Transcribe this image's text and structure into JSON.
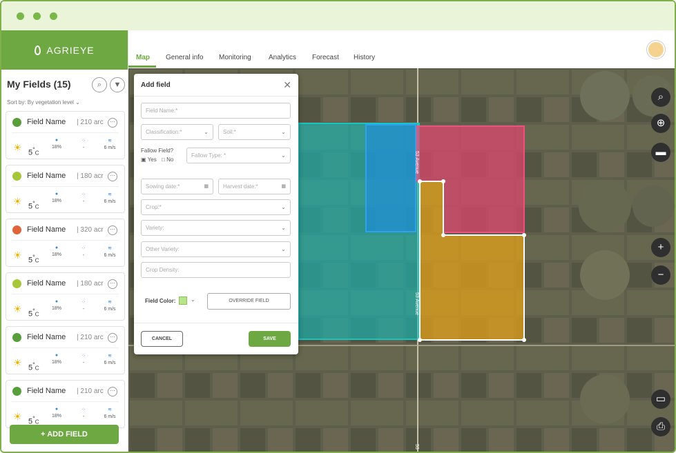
{
  "app": {
    "brand": "AGRIEYE"
  },
  "nav": {
    "tabs": [
      {
        "label": "Map",
        "active": true
      },
      {
        "label": "General info",
        "active": false
      },
      {
        "label": "Monitoring",
        "active": false
      },
      {
        "label": "Analytics",
        "active": false
      },
      {
        "label": "Forecast",
        "active": false
      },
      {
        "label": "History",
        "active": false
      }
    ]
  },
  "sidebar": {
    "title": "My Fields (15)",
    "sort": "Sort by: By vegetation level",
    "fields": [
      {
        "name": "Field Name",
        "area": "210 arc",
        "status_color": "#5a9e3c",
        "temp": "5",
        "temp_unit": "C",
        "humidity": "18%",
        "rain": "-",
        "wind": "6 m/s"
      },
      {
        "name": "Field Name",
        "area": "180 acr",
        "status_color": "#a7c63a",
        "temp": "5",
        "temp_unit": "C",
        "humidity": "18%",
        "rain": "-",
        "wind": "6 m/s"
      },
      {
        "name": "Field Name",
        "area": "320 acr",
        "status_color": "#e0643a",
        "temp": "5",
        "temp_unit": "C",
        "humidity": "18%",
        "rain": "-",
        "wind": "6 m/s"
      },
      {
        "name": "Field Name",
        "area": "180 acr",
        "status_color": "#a7c63a",
        "temp": "5",
        "temp_unit": "C",
        "humidity": "18%",
        "rain": "-",
        "wind": "6 m/s"
      },
      {
        "name": "Field Name",
        "area": "210 arc",
        "status_color": "#5a9e3c",
        "temp": "5",
        "temp_unit": "C",
        "humidity": "18%",
        "rain": "-",
        "wind": "6 m/s"
      },
      {
        "name": "Field Name",
        "area": "210 arc",
        "status_color": "#5a9e3c",
        "temp": "5",
        "temp_unit": "C",
        "humidity": "18%",
        "rain": "-",
        "wind": "6 m/s"
      }
    ],
    "add_button": "+ ADD FIELD"
  },
  "modal": {
    "title": "Add field",
    "field_name_placeholder": "Field Name:*",
    "classification_placeholder": "Classification:*",
    "soil_placeholder": "Soil:*",
    "fallow_label": "Fallow Field?",
    "fallow_yes": "Yes",
    "fallow_no": "No",
    "fallow_type_placeholder": "Fallow Type: *",
    "sowing_placeholder": "Sowing date:*",
    "harvest_placeholder": "Harvest date:*",
    "crop_placeholder": "Crop:*",
    "variety_placeholder": "Variety:",
    "other_variety_placeholder": "Other Variety:",
    "crop_density_placeholder": "Crop Density:",
    "field_color_label": "Field Color:",
    "override_button": "OVERRIDE FIELD",
    "cancel_button": "CANCEL",
    "save_button": "SAVE"
  },
  "map": {
    "road_labels": [
      "53 Avenue",
      "53 Avenue",
      "53"
    ]
  },
  "colors": {
    "accent": "#6da843",
    "field_teal": "#19b3b0",
    "field_blue": "#1f8fd8",
    "field_pink": "#e2446f",
    "field_orange": "#e0a019"
  }
}
